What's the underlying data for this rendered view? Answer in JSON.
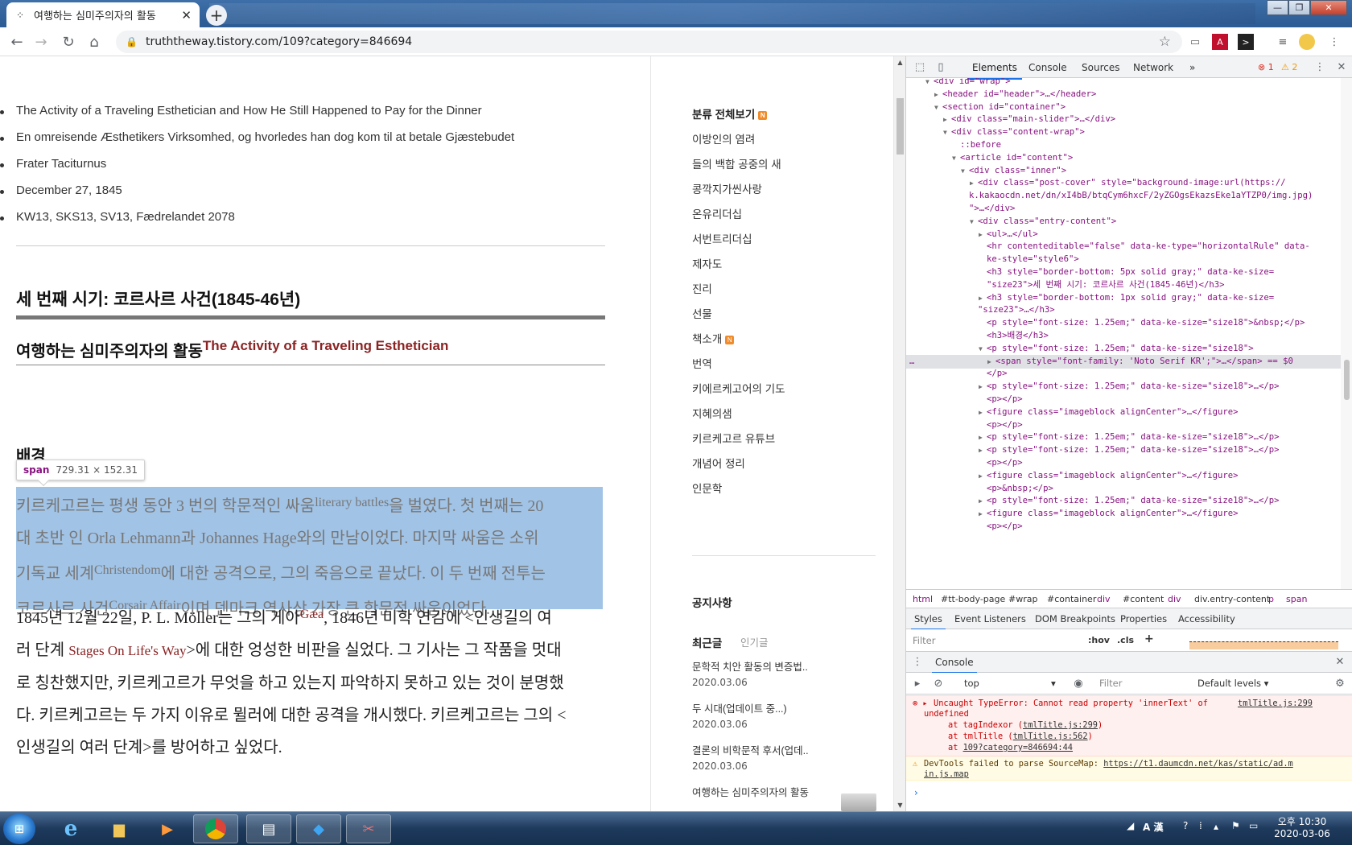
{
  "browser": {
    "tab_title": "여행하는 심미주의자의 활동",
    "url": "truththeway.tistory.com/109?category=846694"
  },
  "article": {
    "bullets": [
      "The Activity of a Traveling Esthetician and How He Still Happened to Pay for the Dinner",
      "En omreisende Æsthetikers Virksomhed, og hvorledes han dog kom til at betale Gjæstebudet",
      "Frater Taciturnus",
      "December 27, 1845",
      "KW13, SKS13, SV13, Fædrelandet 2078"
    ],
    "section_heading": "세 번째 시기: 코르사르 사건(1845-46년)",
    "sub_heading": "여행하는 심미주의자의 활동",
    "sub_heading_sup": "The Activity of a Traveling Esthetician",
    "background_heading": "배경",
    "tooltip_tag": "span",
    "tooltip_dims": "729.31 × 152.31",
    "para1": {
      "l1a": "키르케고르는 평생 동안 3 번의 학문적인 싸움",
      "l1sup": "literary battles",
      "l1b": "을 벌였다. 첫 번째는 20",
      "l2": "대 초반 인 Orla Lehmann과 Johannes Hage와의 만남이었다. 마지막 싸움은 소위",
      "l3a": "기독교 세계",
      "l3sup": "Christendom",
      "l3b": "에 대한 공격으로, 그의 죽음으로 끝났다. 이 두 번째 전투는",
      "l4a": "코르사르 사건",
      "l4sup": "Corsair Affair",
      "l4b": "이며 덴마크 역사상 가장 큰 학문적 싸움이었다."
    },
    "para2": {
      "l1a": "1845년 12월 22일, P. L. Möller는 그의 게아",
      "l1sup": "Gæa",
      "l1b": ", 1846년 미학 연감에 <인생길의 여",
      "l2a": "러 단계 ",
      "l2red": "Stages On Life's Way",
      "l2b": ">에 대한 엉성한 비판을 실었다. 그 기사는 그 작품을 멋대",
      "l3": "로 칭찬했지만, 키르케고르가 무엇을 하고 있는지 파악하지 못하고 있는 것이 분명했",
      "l4": "다. 키르케고르는 두 가지 이유로 뮐러에 대한 공격을 개시했다. 키르케고르는 그의 <",
      "l5": "인생길의 여러 단계>를 방어하고 싶었다."
    }
  },
  "sidebar": {
    "category_title": "분류 전체보기",
    "categories": [
      "이방인의 염려",
      "들의 백합 공중의 새",
      "콩깍지가씬사랑",
      "온유리더십",
      "서번트리더십",
      "제자도",
      "진리",
      "선물",
      "책소개",
      "번역",
      "키에르케고어의 기도",
      "지혜의샘",
      "키르케고르 유튜브",
      "개념어 정리",
      "인문학"
    ],
    "notice": "공지사항",
    "recent_tab": "최근글",
    "popular_tab": "인기글",
    "recent": [
      {
        "title": "문학적 치안 활동의 변증법..",
        "date": "2020.03.06"
      },
      {
        "title": "두 시대(업데이트 중...)",
        "date": "2020.03.06"
      },
      {
        "title": "결론의 비학문적 후서(업데..",
        "date": "2020.03.06"
      },
      {
        "title": "여행하는 심미주의자의 활동",
        "date": ""
      }
    ]
  },
  "devtools": {
    "tabs": [
      "Elements",
      "Console",
      "Sources",
      "Network"
    ],
    "more": "»",
    "errors": "1",
    "warnings": "2",
    "dom_lines": [
      {
        "i": 2,
        "t": "▼",
        "h": "<div id=\"wrap\">"
      },
      {
        "i": 3,
        "t": "▶",
        "h": "<header id=\"header\">…</header>"
      },
      {
        "i": 3,
        "t": "▼",
        "h": "<section id=\"container\">"
      },
      {
        "i": 4,
        "t": "▶",
        "h": "<div class=\"main-slider\">…</div>"
      },
      {
        "i": 4,
        "t": "▼",
        "h": "<div class=\"content-wrap\">"
      },
      {
        "i": 5,
        "t": "",
        "h": "::before"
      },
      {
        "i": 5,
        "t": "▼",
        "h": "<article id=\"content\">"
      },
      {
        "i": 6,
        "t": "▼",
        "h": "<div class=\"inner\">"
      },
      {
        "i": 7,
        "t": "▶",
        "h": "<div class=\"post-cover\" style=\"background-image:url(https://"
      },
      {
        "i": 6,
        "t": "",
        "h": "k.kakaocdn.net/dn/xI4bB/btqCym6hxcF/2yZGOgsEkazsEke1aYTZP0/img.jpg)"
      },
      {
        "i": 6,
        "t": "",
        "h": "\">…</div>"
      },
      {
        "i": 7,
        "t": "▼",
        "h": "<div class=\"entry-content\">"
      },
      {
        "i": 8,
        "t": "▶",
        "h": "<ul>…</ul>"
      },
      {
        "i": 8,
        "t": "",
        "h": "<hr contenteditable=\"false\" data-ke-type=\"horizontalRule\" data-"
      },
      {
        "i": 8,
        "t": "",
        "h": "ke-style=\"style6\">"
      },
      {
        "i": 8,
        "t": "",
        "h": "<h3 style=\"border-bottom: 5px  solid gray;\" data-ke-size="
      },
      {
        "i": 8,
        "t": "",
        "h": "\"size23\">세 번째 시기: 코르사르 사건(1845-46년)</h3>"
      },
      {
        "i": 8,
        "t": "▶",
        "h": "<h3 style=\"border-bottom: 1px  solid gray;\" data-ke-size="
      },
      {
        "i": 7,
        "t": "",
        "h": "\"size23\">…</h3>"
      },
      {
        "i": 8,
        "t": "",
        "h": "<p style=\"font-size: 1.25em;\" data-ke-size=\"size18\">&nbsp;</p>"
      },
      {
        "i": 8,
        "t": "",
        "h": "<h3>배경</h3>"
      },
      {
        "i": 8,
        "t": "▼",
        "h": "<p style=\"font-size: 1.25em;\" data-ke-size=\"size18\">"
      },
      {
        "i": 9,
        "t": "▶",
        "h": "<span style=\"font-family: 'Noto Serif KR';\">…</span> == $0",
        "sel": true
      },
      {
        "i": 8,
        "t": "",
        "h": "</p>"
      },
      {
        "i": 8,
        "t": "▶",
        "h": "<p style=\"font-size: 1.25em;\" data-ke-size=\"size18\">…</p>"
      },
      {
        "i": 8,
        "t": "",
        "h": "<p></p>"
      },
      {
        "i": 8,
        "t": "▶",
        "h": "<figure class=\"imageblock alignCenter\">…</figure>"
      },
      {
        "i": 8,
        "t": "",
        "h": "<p></p>"
      },
      {
        "i": 8,
        "t": "▶",
        "h": "<p style=\"font-size: 1.25em;\" data-ke-size=\"size18\">…</p>"
      },
      {
        "i": 8,
        "t": "▶",
        "h": "<p style=\"font-size: 1.25em;\" data-ke-size=\"size18\">…</p>"
      },
      {
        "i": 8,
        "t": "",
        "h": "<p></p>"
      },
      {
        "i": 8,
        "t": "▶",
        "h": "<figure class=\"imageblock alignCenter\">…</figure>"
      },
      {
        "i": 8,
        "t": "",
        "h": "<p>&nbsp;</p>"
      },
      {
        "i": 8,
        "t": "▶",
        "h": "<p style=\"font-size: 1.25em;\" data-ke-size=\"size18\">…</p>"
      },
      {
        "i": 8,
        "t": "▶",
        "h": "<figure class=\"imageblock alignCenter\">…</figure>"
      },
      {
        "i": 8,
        "t": "",
        "h": "<p></p>"
      }
    ],
    "breadcrumbs": [
      "html",
      "#tt-body-page",
      "#wrap",
      "#container",
      "div",
      "#content",
      "div",
      "div.entry-content",
      "p",
      "span"
    ],
    "style_tabs": [
      "Styles",
      "Event Listeners",
      "DOM Breakpoints",
      "Properties",
      "Accessibility"
    ],
    "filter_placeholder": "Filter",
    "hov": ":hov",
    "cls": ".cls",
    "console_title": "Console",
    "context": "top",
    "console_filter": "Filter",
    "levels": "Default levels ▾",
    "error_line1": "Uncaught TypeError: Cannot read property 'innerText' of",
    "error_link1": "tmlTitle.js:299",
    "error_line2": "undefined",
    "error_at1": "at tagIndexor (",
    "error_at1_link": "tmlTitle.js:299",
    "error_at2": "at tmlTitle (",
    "error_at2_link": "tmlTitle.js:562",
    "error_at3": "at ",
    "error_at3_link": "109?category=846694:44",
    "warn_line1": "DevTools failed to parse SourceMap: ",
    "warn_link1": "https://t1.daumcdn.net/kas/static/ad.m",
    "warn_link2": "in.js.map"
  },
  "taskbar": {
    "time": "오후 10:30",
    "date": "2020-03-06",
    "ime": "A 漢"
  }
}
